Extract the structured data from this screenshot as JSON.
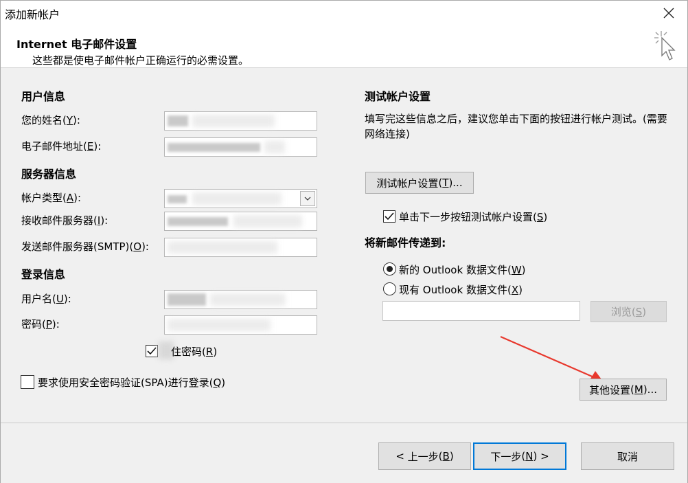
{
  "window": {
    "title": "添加新帐户"
  },
  "header": {
    "title": "Internet 电子邮件设置",
    "subtitle": "这些都是使电子邮件帐户正确运行的必需设置。"
  },
  "user_info": {
    "heading": "用户信息",
    "name_label": "您的姓名",
    "name_key": "Y",
    "email_label": "电子邮件地址",
    "email_key": "E"
  },
  "server_info": {
    "heading": "服务器信息",
    "account_type_label": "帐户类型",
    "account_type_key": "A",
    "incoming_label": "接收邮件服务器",
    "incoming_key": "I",
    "outgoing_label": "发送邮件服务器(SMTP)",
    "outgoing_key": "O"
  },
  "login_info": {
    "heading": "登录信息",
    "username_label": "用户名",
    "username_key": "U",
    "password_label": "密码",
    "password_key": "P",
    "remember_label_visible": "住密码",
    "remember_key": "R",
    "remember_checked": true,
    "spa_label": "要求使用安全密码验证(SPA)进行登录",
    "spa_key": "Q",
    "spa_checked": false
  },
  "test_settings": {
    "heading": "测试帐户设置",
    "description": "填写完这些信息之后，建议您单击下面的按钮进行帐户测试。(需要网络连接)",
    "test_button": "测试帐户设置",
    "test_key": "T",
    "auto_test_label": "单击下一步按钮测试帐户设置",
    "auto_test_key": "S",
    "auto_test_checked": true
  },
  "deliver_to": {
    "heading": "将新邮件传递到:",
    "new_file_label": "新的 Outlook 数据文件",
    "new_file_key": "W",
    "new_file_selected": true,
    "existing_file_label": "现有 Outlook 数据文件",
    "existing_file_key": "X",
    "existing_file_selected": false,
    "path_value": "",
    "browse_button": "浏览",
    "browse_key": "S"
  },
  "more_settings": {
    "label": "其他设置",
    "key": "M"
  },
  "footer": {
    "back_label": "上一步",
    "back_key": "B",
    "next_label": "下一步",
    "next_key": "N",
    "cancel_label": "取消"
  },
  "colors": {
    "accent": "#0078d7",
    "arrow": "#e8382d"
  }
}
